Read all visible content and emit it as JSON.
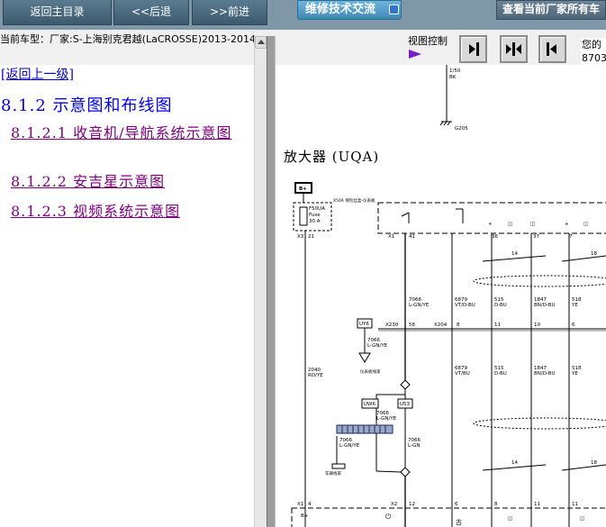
{
  "toolbar": {
    "home_label": "返回主目录",
    "back_label": "<<后退",
    "forward_label": ">>前进",
    "forum_tab": "维修技术交流",
    "query_tab": "查看当前厂家所有车"
  },
  "info": {
    "car_label": "当前车型：厂家:S-上海别克君越(LaCROSSE)2013-2014",
    "view_control": "视图控制",
    "side_line1": "您的",
    "side_line2": "8703"
  },
  "left": {
    "back_link": "[返回上一级]",
    "section_title": "8.1.2 示意图和布线图",
    "items": [
      "8.1.2.1 收音机/导航系统示意图",
      "8.1.2.2 安吉星示意图",
      "8.1.2.3 视频系统示意图"
    ]
  },
  "diagram": {
    "title": "放大器 (UQA)",
    "top_wire_gauge": "1/50",
    "top_wire_color": "BK",
    "ground_label": "G205",
    "fuse_name": "F50UA",
    "fuse_label": "Fuse",
    "fuse_rating": "30 A",
    "fuse_note": "X50A 保险丝盒-仪表板",
    "connector_x3": "X3",
    "connector_x1": "X1",
    "pin_21": "21",
    "pin_41": "41",
    "pin_36": "36",
    "pin_37": "37",
    "pin_7": "7",
    "wire_2040_num": "2040",
    "wire_2040_color": "RD/YE",
    "wire_7066_num": "7066",
    "wire_7066_color": "L-GN/YE",
    "wire_6879_num": "6879",
    "wire_6879_color": "VT/D-BU",
    "wire_515_num": "515",
    "wire_515_color": "D-BU",
    "wire_1847_num": "1847",
    "wire_1847_color": "BN/D-BU",
    "wire_518_num": "518",
    "wire_518_color": "YE",
    "splice_uy6": "UY6",
    "splice_x230": "X230",
    "splice_x204": "X204",
    "splice_uw6": "UW6",
    "splice_u53": "U53",
    "pin_58": "58",
    "pin_8": "8",
    "pin_11": "11",
    "pin_10": "10",
    "pin_6": "6",
    "side_label_1": "仪表板线束",
    "side_label_2": "车辆线束",
    "wire_7066b_color": "L-GN/YE",
    "wire_7066c_color": "L-GN",
    "wire_lsr": "L-GN",
    "bot_pin_4": "4",
    "bot_pin_12": "12",
    "bot_x1": "X1",
    "bot_x2": "X2",
    "bot_label_b": "B+",
    "count_14": "14",
    "count_18": "18"
  }
}
